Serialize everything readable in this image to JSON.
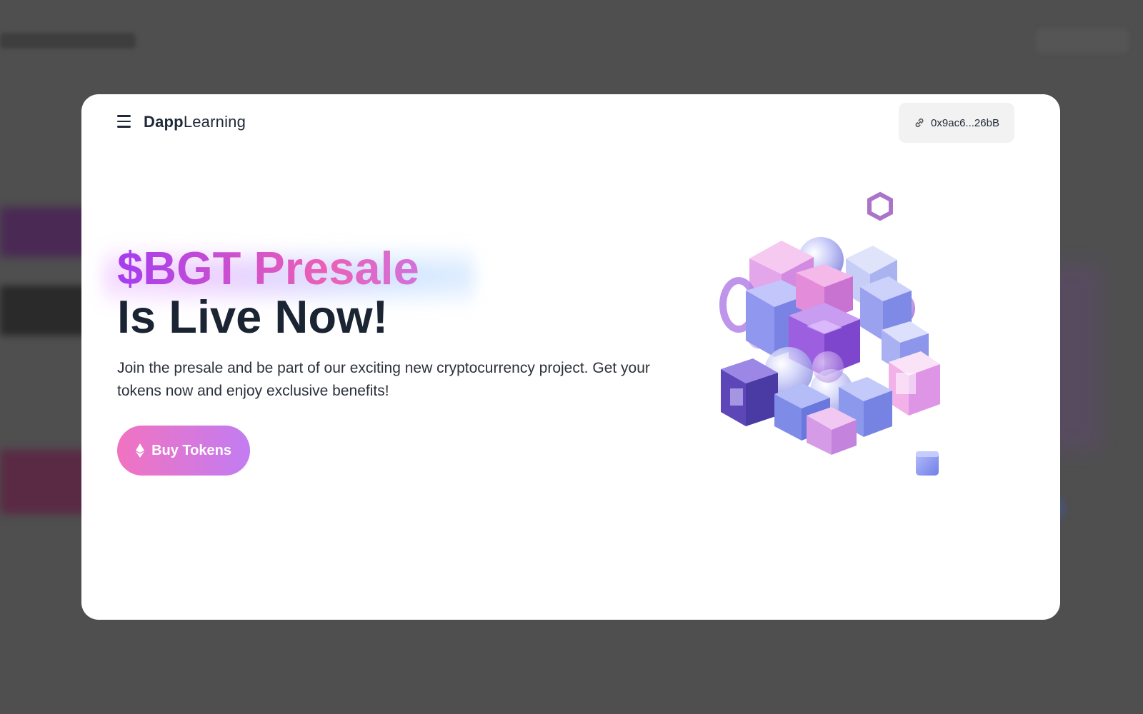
{
  "header": {
    "menu_icon": "menu-icon",
    "brand_bold": "Dapp",
    "brand_light": "Learning",
    "wallet_icon": "link-icon",
    "wallet_address": "0x9ac6...26bB"
  },
  "hero": {
    "title_line1": "$BGT Presale",
    "title_line2": "Is Live Now!",
    "description": "Join the presale and be part of our exciting new cryptocurrency project. Get your tokens now and enjoy exclusive benefits!",
    "button_label": "Buy Tokens",
    "button_icon": "ethereum-icon",
    "illustration": "crypto-cubes-illustration"
  },
  "colors": {
    "overlay": "#4f4f4f",
    "title_gradient_start": "#a43df0",
    "title_gradient_mid": "#ec5fb4",
    "title_gradient_end": "#58a6f8",
    "button_gradient_start": "#f173c0",
    "button_gradient_end": "#c27cf2",
    "heading_dark": "#1b2433"
  }
}
